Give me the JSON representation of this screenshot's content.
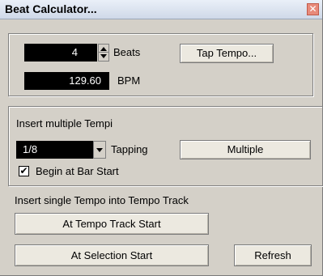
{
  "window": {
    "title": "Beat Calculator...",
    "close_glyph": "✕"
  },
  "calculator": {
    "beats_value": "4",
    "beats_label": "Beats",
    "bpm_value": "129.60",
    "bpm_label": "BPM",
    "tap_tempo_label": "Tap Tempo..."
  },
  "multiple": {
    "heading": "Insert multiple Tempi",
    "tapping_value": "1/8",
    "tapping_label": "Tapping",
    "multiple_label": "Multiple",
    "begin_checkbox_label": "Begin at Bar Start",
    "begin_checked": true,
    "check_glyph": "✔"
  },
  "single": {
    "heading": "Insert single Tempo into Tempo Track",
    "at_tempo_track_start_label": "At Tempo Track Start",
    "at_selection_start_label": "At Selection Start",
    "refresh_label": "Refresh"
  }
}
